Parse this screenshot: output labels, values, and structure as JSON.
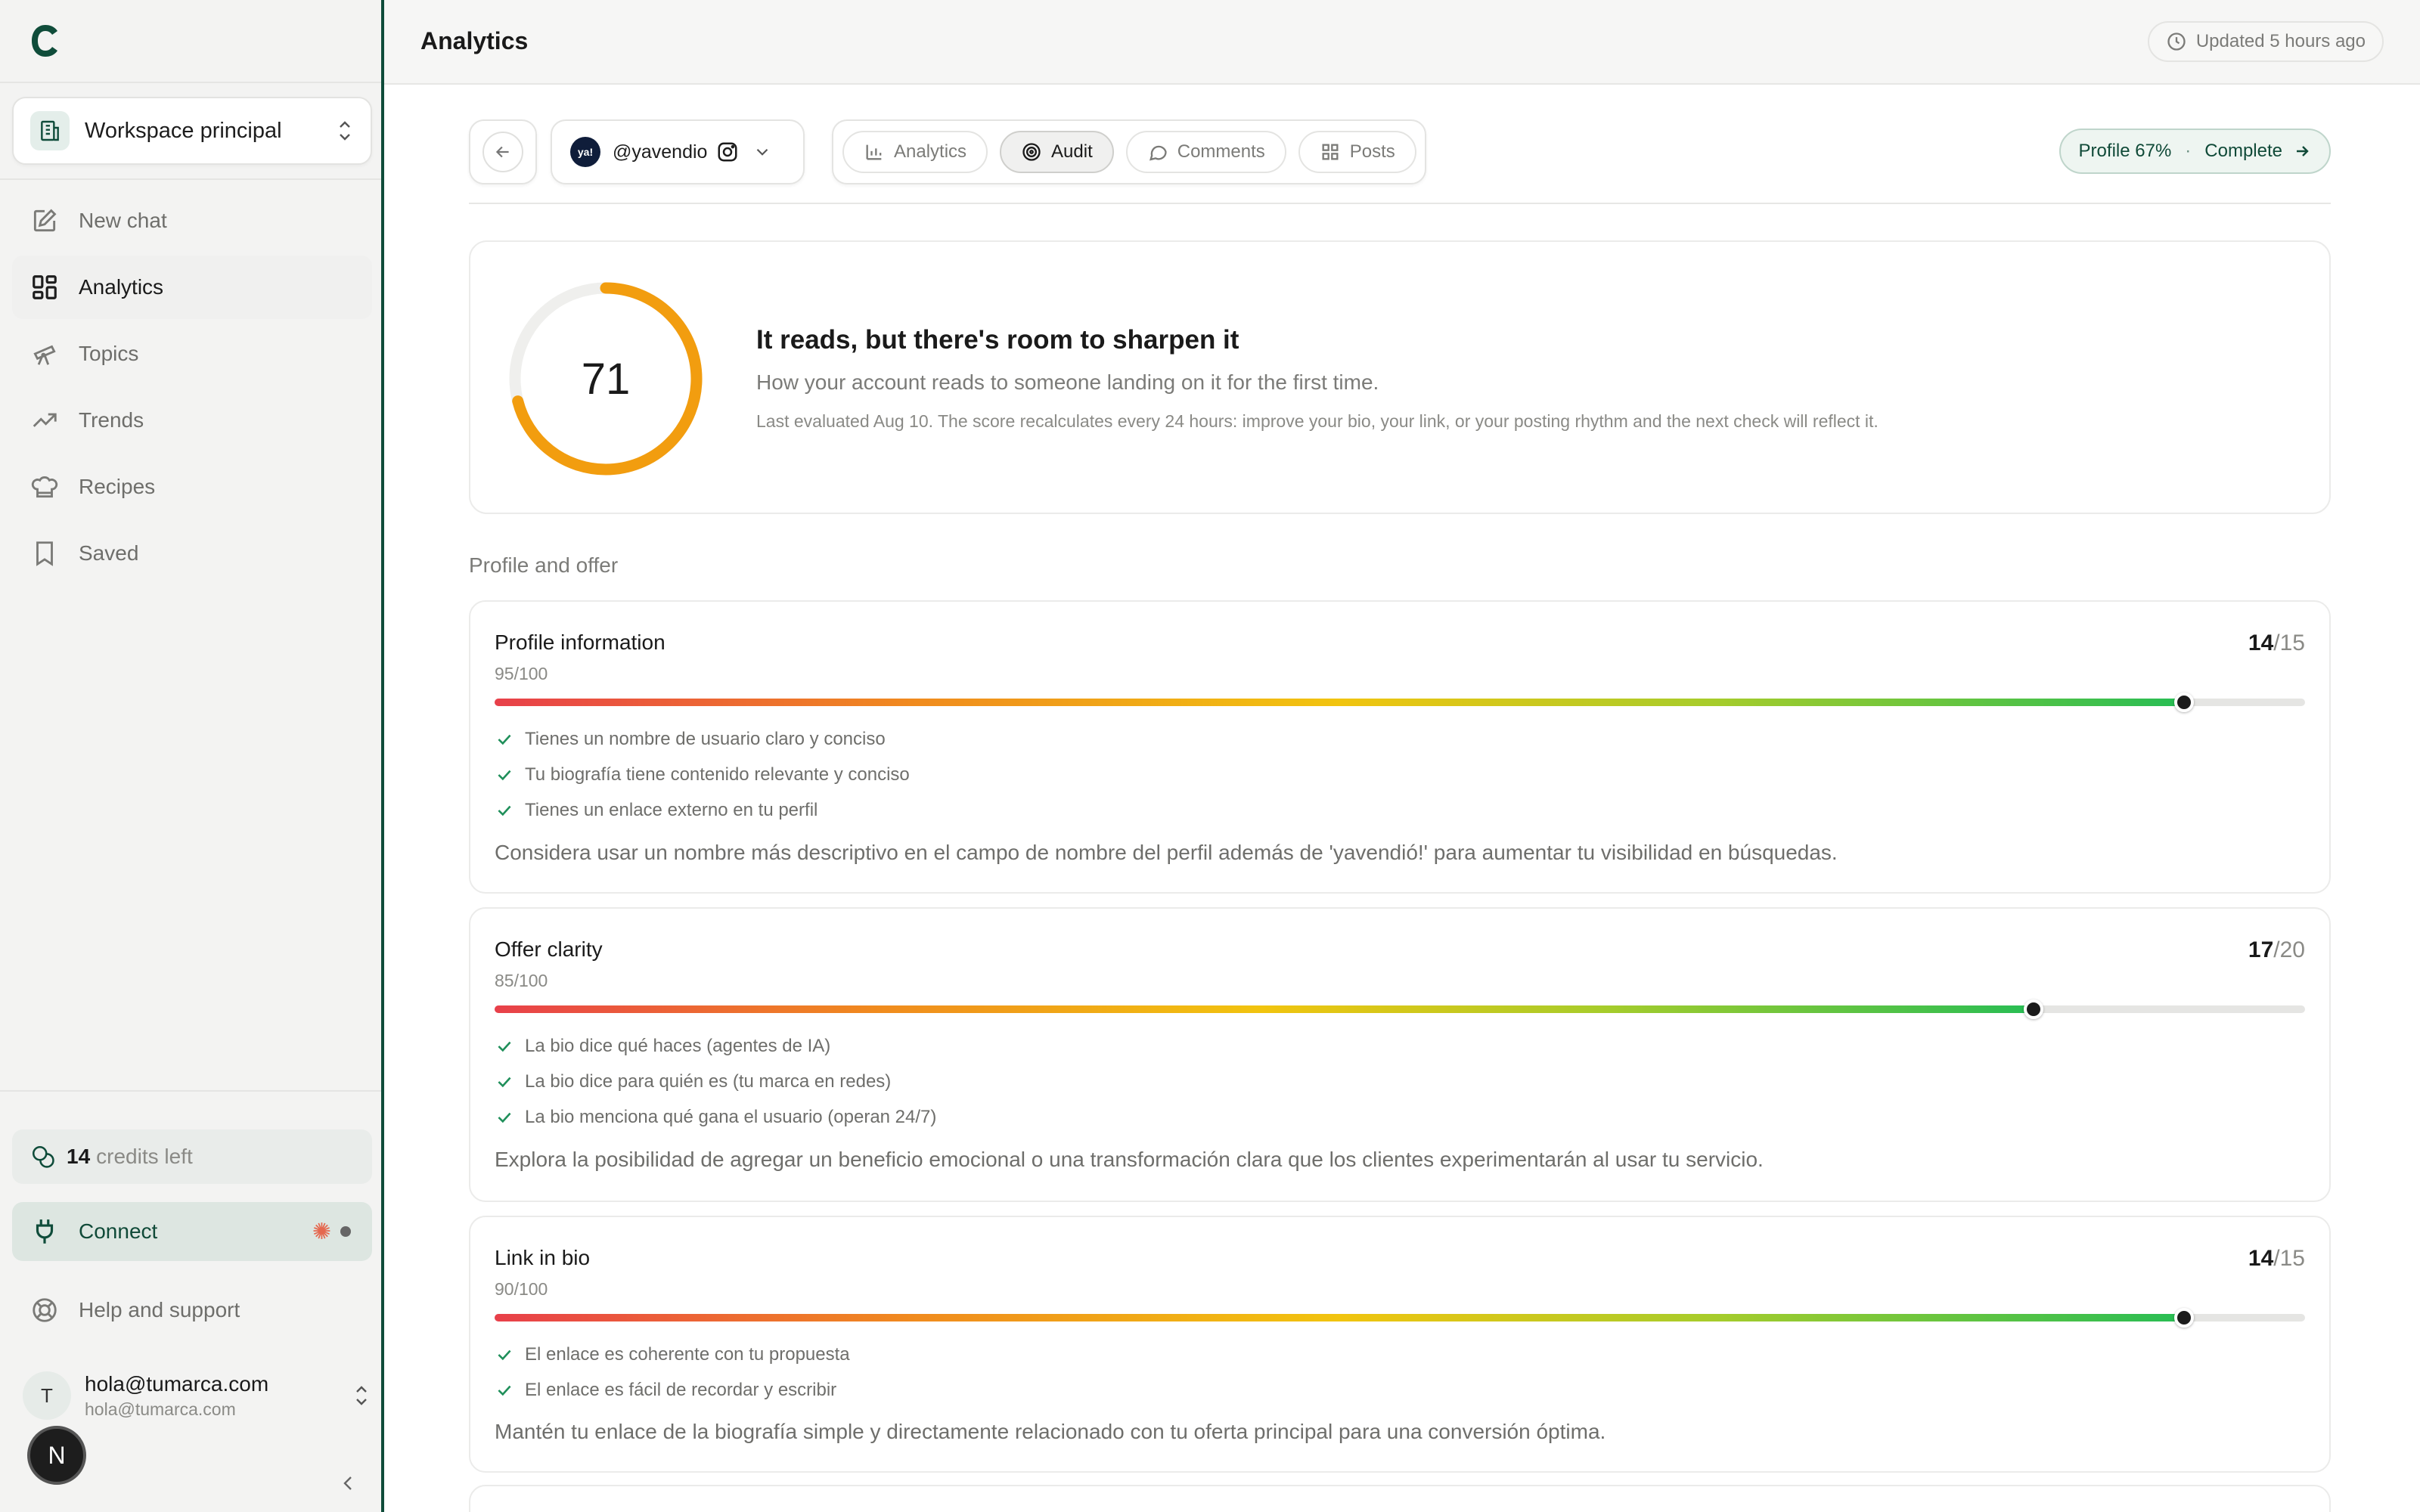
{
  "app": {
    "logo_letter": "C"
  },
  "workspace": {
    "name": "Workspace principal"
  },
  "nav": [
    {
      "label": "New chat",
      "icon": "edit-icon",
      "active": false
    },
    {
      "label": "Analytics",
      "icon": "dashboard-icon",
      "active": true
    },
    {
      "label": "Topics",
      "icon": "telescope-icon",
      "active": false
    },
    {
      "label": "Trends",
      "icon": "trending-up-icon",
      "active": false
    },
    {
      "label": "Recipes",
      "icon": "chef-hat-icon",
      "active": false
    },
    {
      "label": "Saved",
      "icon": "bookmark-icon",
      "active": false
    }
  ],
  "credits": {
    "count": "14",
    "label": "credits left"
  },
  "connect": {
    "label": "Connect"
  },
  "help": {
    "label": "Help and support"
  },
  "user": {
    "initial": "T",
    "name": "hola@tumarca.com",
    "email": "hola@tumarca.com"
  },
  "n_badge": "N",
  "header": {
    "title": "Analytics",
    "updated": "Updated 5 hours ago"
  },
  "account": {
    "avatar_text": "ya!",
    "handle": "@yavendio"
  },
  "tabs": [
    {
      "label": "Analytics",
      "icon": "bar-chart-icon",
      "active": false
    },
    {
      "label": "Audit",
      "icon": "target-icon",
      "active": true
    },
    {
      "label": "Comments",
      "icon": "message-circle-icon",
      "active": false
    },
    {
      "label": "Posts",
      "icon": "grid-icon",
      "active": false
    }
  ],
  "profile_pill": {
    "progress": "Profile 67%",
    "separator": "·",
    "action": "Complete"
  },
  "score": {
    "value": "71",
    "fraction": 0.71,
    "title": "It reads, but there's room to sharpen it",
    "subtitle": "How your account reads to someone landing on it for the first time.",
    "note": "Last evaluated Aug 10. The score recalculates every 24 hours: improve your bio, your link, or your posting rhythm and the next check will reflect it."
  },
  "section": {
    "title": "Profile and offer"
  },
  "criteria": [
    {
      "title": "Profile information",
      "sub": "95/100",
      "got": "14",
      "max": "15",
      "level": 0.933,
      "checks": [
        "Tienes un nombre de usuario claro y conciso",
        "Tu biografía tiene contenido relevante y conciso",
        "Tienes un enlace externo en tu perfil"
      ],
      "advice": "Considera usar un nombre más descriptivo en el campo de nombre del perfil además de 'yavendió!' para aumentar tu visibilidad en búsquedas."
    },
    {
      "title": "Offer clarity",
      "sub": "85/100",
      "got": "17",
      "max": "20",
      "level": 0.85,
      "checks": [
        "La bio dice qué haces (agentes de IA)",
        "La bio dice para quién es (tu marca en redes)",
        "La bio menciona qué gana el usuario (operan 24/7)"
      ],
      "advice": "Explora la posibilidad de agregar un beneficio emocional o una transformación clara que los clientes experimentarán al usar tu servicio."
    },
    {
      "title": "Link in bio",
      "sub": "90/100",
      "got": "14",
      "max": "15",
      "level": 0.933,
      "checks": [
        "El enlace es coherente con tu propuesta",
        "El enlace es fácil de recordar y escribir"
      ],
      "advice": "Mantén tu enlace de la biografía simple y directamente relacionado con tu oferta principal para una conversión óptima."
    }
  ],
  "colors": {
    "brand": "#0f4c3a",
    "ring": "#f29d0f",
    "knob": "#1b1b1b"
  }
}
